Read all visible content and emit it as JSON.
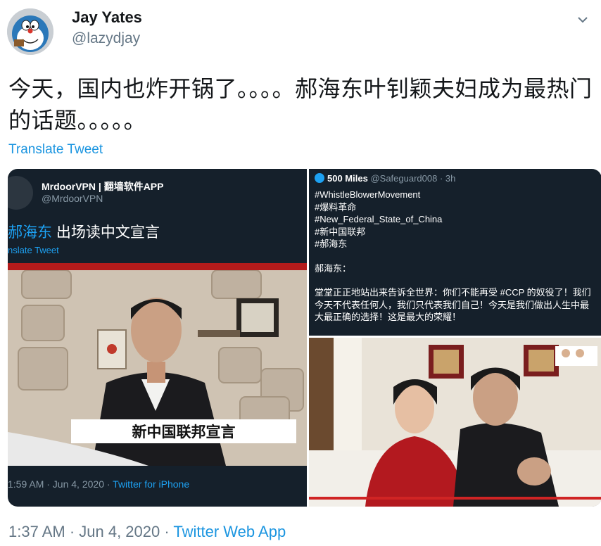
{
  "user": {
    "name": "Jay Yates",
    "handle": "@lazydjay"
  },
  "tweet": {
    "text": "今天，国内也炸开锅了。。。。郝海东叶钊颖夫妇成为最热门的话题。。。。。",
    "translate_label": "Translate Tweet"
  },
  "media": {
    "panel1": {
      "author_name": "MrdoorVPN | 翻墙软件APP",
      "author_handle": "@MrdoorVPN",
      "text_highlight": "郝海东",
      "text_rest": " 出场读中文宣言",
      "translate_label": "nslate Tweet",
      "video_caption": "新中国联邦宣言",
      "meta_time": "1:59 AM · Jun 4, 2020 · ",
      "meta_source": "Twitter for iPhone"
    },
    "panel2": {
      "author_name": "500 Miles",
      "author_handle": "@Safeguard008",
      "time": "· 3h",
      "hashtags": [
        "#WhistleBlowerMovement",
        "#爆料革命",
        "#New_Federal_State_of_China",
        "#新中国联邦",
        "#郝海东"
      ],
      "speaker": "郝海东：",
      "quote": "堂堂正正地站出来告诉全世界：你们不能再受 #CCP 的奴役了！我们今天不代表任何人，我们只代表我们自己！今天是我们做出人生中最大最正确的选择！这是最大的荣耀！"
    }
  },
  "footer": {
    "time": "1:37 AM · Jun 4, 2020 · ",
    "app": "Twitter Web App"
  },
  "colors": {
    "link": "#1b95e0",
    "dark_panel": "#15202b",
    "muted": "#657786"
  }
}
